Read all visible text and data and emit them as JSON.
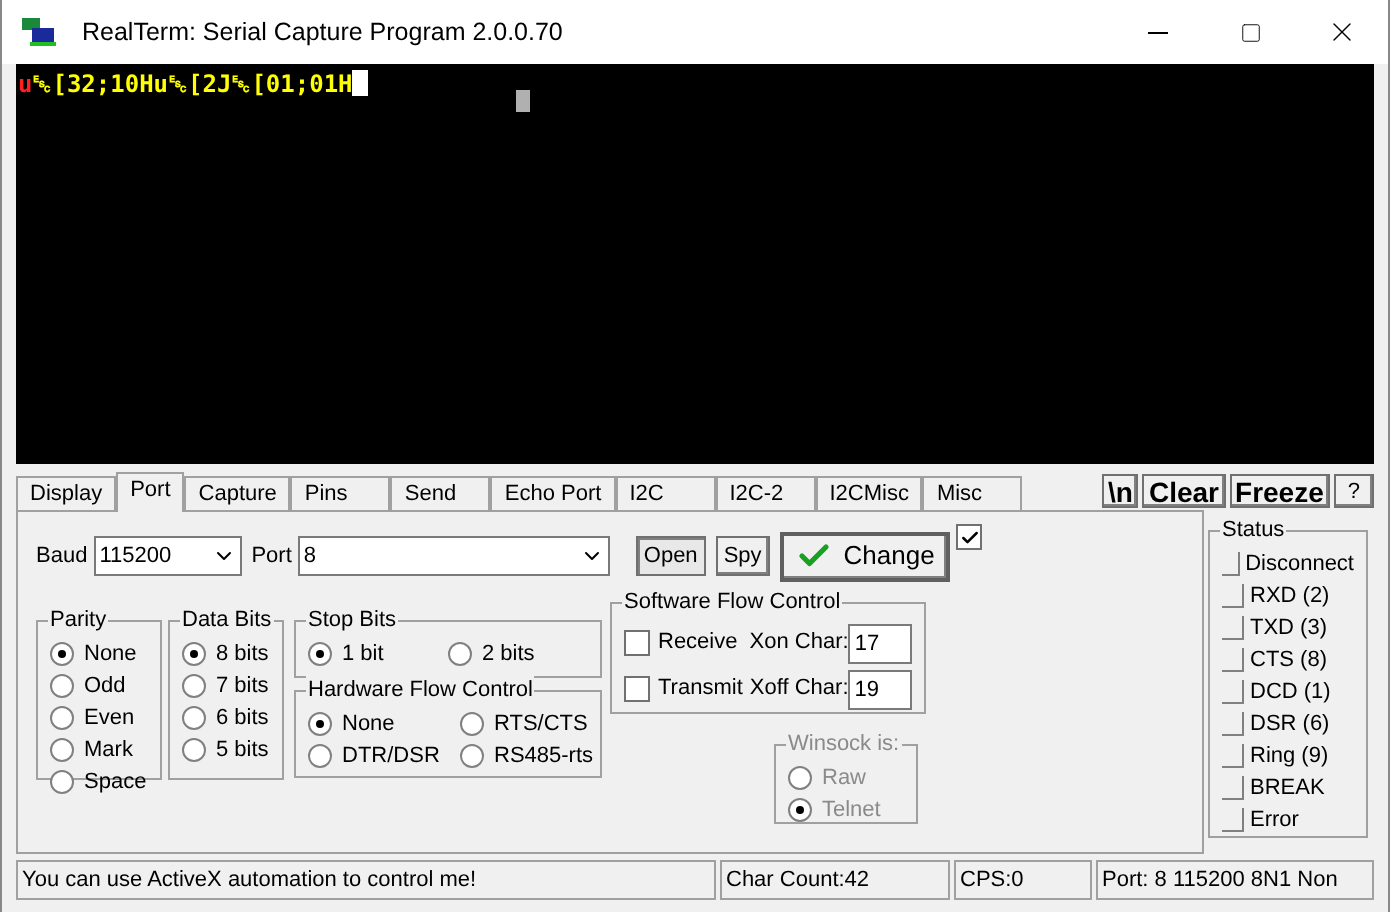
{
  "window": {
    "title": "RealTerm: Serial Capture Program 2.0.0.70"
  },
  "terminal": {
    "segments": [
      {
        "text": "u",
        "color": "#ff2020"
      },
      {
        "text": "␛[32;10Hu␛[2J␛[01;01H",
        "color": "#ffff00"
      }
    ]
  },
  "tabs": [
    {
      "label": "Display",
      "selected": false
    },
    {
      "label": "Port",
      "selected": true
    },
    {
      "label": "Capture",
      "selected": false
    },
    {
      "label": "Pins",
      "selected": false
    },
    {
      "label": "Send",
      "selected": false
    },
    {
      "label": "Echo Port",
      "selected": false
    },
    {
      "label": "I2C",
      "selected": false
    },
    {
      "label": "I2C-2",
      "selected": false
    },
    {
      "label": "I2CMisc",
      "selected": false
    },
    {
      "label": "Misc",
      "selected": false
    }
  ],
  "toolbar_buttons": [
    "\\n",
    "Clear",
    "Freeze",
    "?"
  ],
  "port": {
    "baud_label": "Baud",
    "baud": "115200",
    "port_label": "Port",
    "port": "8",
    "open": "Open",
    "spy": "Spy",
    "change": "Change",
    "auto_checked": true
  },
  "parity": {
    "title": "Parity",
    "options": [
      {
        "label": "None",
        "selected": true
      },
      {
        "label": "Odd",
        "selected": false
      },
      {
        "label": "Even",
        "selected": false
      },
      {
        "label": "Mark",
        "selected": false
      },
      {
        "label": "Space",
        "selected": false
      }
    ]
  },
  "data_bits": {
    "title": "Data Bits",
    "options": [
      {
        "label": "8 bits",
        "selected": true
      },
      {
        "label": "7 bits",
        "selected": false
      },
      {
        "label": "6 bits",
        "selected": false
      },
      {
        "label": "5 bits",
        "selected": false
      }
    ]
  },
  "stop_bits": {
    "title": "Stop Bits",
    "options": [
      {
        "label": "1 bit",
        "selected": true
      },
      {
        "label": "2 bits",
        "selected": false
      }
    ]
  },
  "hardware_flow": {
    "title": "Hardware Flow Control",
    "options": [
      {
        "label": "None",
        "selected": true
      },
      {
        "label": "RTS/CTS",
        "selected": false
      },
      {
        "label": "DTR/DSR",
        "selected": false
      },
      {
        "label": "RS485-rts",
        "selected": false
      }
    ]
  },
  "software_flow": {
    "title": "Software Flow Control",
    "items": [
      {
        "label": "Receive",
        "checked": false,
        "char_label": "Xon Char:",
        "value": "17"
      },
      {
        "label": "Transmit",
        "checked": false,
        "char_label": "Xoff Char:",
        "value": "19"
      }
    ]
  },
  "winsock": {
    "title": "Winsock is:",
    "disabled": true,
    "options": [
      {
        "label": "Raw",
        "selected": false
      },
      {
        "label": "Telnet",
        "selected": true
      }
    ]
  },
  "status": {
    "title": "Status",
    "items": [
      {
        "label": "Disconnect",
        "on": false
      },
      {
        "label": "RXD (2)",
        "on": false
      },
      {
        "label": "TXD (3)",
        "on": false
      },
      {
        "label": "CTS (8)",
        "on": false
      },
      {
        "label": "DCD (1)",
        "on": false
      },
      {
        "label": "DSR (6)",
        "on": false
      },
      {
        "label": "Ring (9)",
        "on": false
      },
      {
        "label": "BREAK",
        "on": false
      },
      {
        "label": "Error",
        "on": false
      }
    ]
  },
  "status_bar": [
    "You can use ActiveX automation to control me!",
    "Char Count:42",
    "CPS:0",
    "Port: 8 115200 8N1 Non"
  ]
}
